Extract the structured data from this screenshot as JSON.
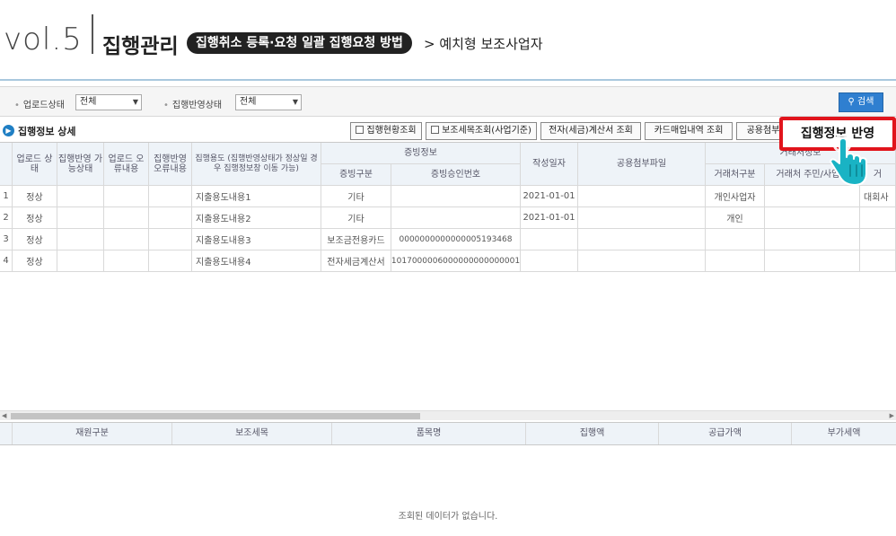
{
  "banner": {
    "vol": "vol.5",
    "title": "집행관리",
    "pill": "집행취소 등록·요청 일괄 집행요청 방법",
    "subtitle": "> 예치형 보조사업자"
  },
  "filters": {
    "upload_status_label": "업로드상태",
    "upload_status_value": "전체",
    "apply_status_label": "집행반영상태",
    "apply_status_value": "전체",
    "search_label": "검색"
  },
  "section": {
    "title": "집행정보 상세",
    "buttons": {
      "exec_status": "집행현황조회",
      "subitem": "보조세목조회(사업기준)",
      "einvoice": "전자(세금)계산서 조회",
      "card": "카드매입내역 조회",
      "shared": "공용첨부",
      "apply": "집행정보 반영"
    }
  },
  "grid": {
    "headers": {
      "upload_status": "업로드 상태",
      "apply_possible": "집행반영 가능상태",
      "upload_error": "업로드 오류내용",
      "apply_error": "집행반영 오류내용",
      "purpose": "집행용도 (집행반영상태가 정상일 경우 집행정보창 이동 가능)",
      "evidence": "증빙정보",
      "evidence_type": "증빙구분",
      "evidence_no": "증빙승인번호",
      "date": "작성일자",
      "attach": "공용첨부파일",
      "partner": "거래처정보",
      "partner_type": "거래처구분",
      "partner_id": "거래처 주민/사업자",
      "partner_name": "거"
    },
    "rows": [
      {
        "no": "1",
        "status": "정상",
        "purpose": "지출용도내용1",
        "evidence_type": "기타",
        "evidence_no": "",
        "date": "2021-01-01",
        "partner_type": "개인사업자",
        "partner_name": "대회사"
      },
      {
        "no": "2",
        "status": "정상",
        "purpose": "지출용도내용2",
        "evidence_type": "기타",
        "evidence_no": "",
        "date": "2021-01-01",
        "partner_type": "개인",
        "partner_name": ""
      },
      {
        "no": "3",
        "status": "정상",
        "purpose": "지출용도내용3",
        "evidence_type": "보조금전용카드",
        "evidence_no": "0000000000000005193468",
        "date": "",
        "partner_type": "",
        "partner_name": ""
      },
      {
        "no": "4",
        "status": "정상",
        "purpose": "지출용도내용4",
        "evidence_type": "전자세금계산서",
        "evidence_no": "1017000006000000000000001",
        "date": "",
        "partner_type": "",
        "partner_name": ""
      }
    ]
  },
  "detail_grid": {
    "headers": [
      "재원구분",
      "보조세목",
      "품목명",
      "집행액",
      "공급가액",
      "부가세액"
    ],
    "empty_message": "조회된 데이터가 없습니다."
  },
  "callout": {
    "text": "집행정보 반영"
  },
  "colors": {
    "accent": "#2f7fd0",
    "callout_border": "#e1141c",
    "header_bg": "#eef3f8",
    "hand": "#19b3c4"
  }
}
